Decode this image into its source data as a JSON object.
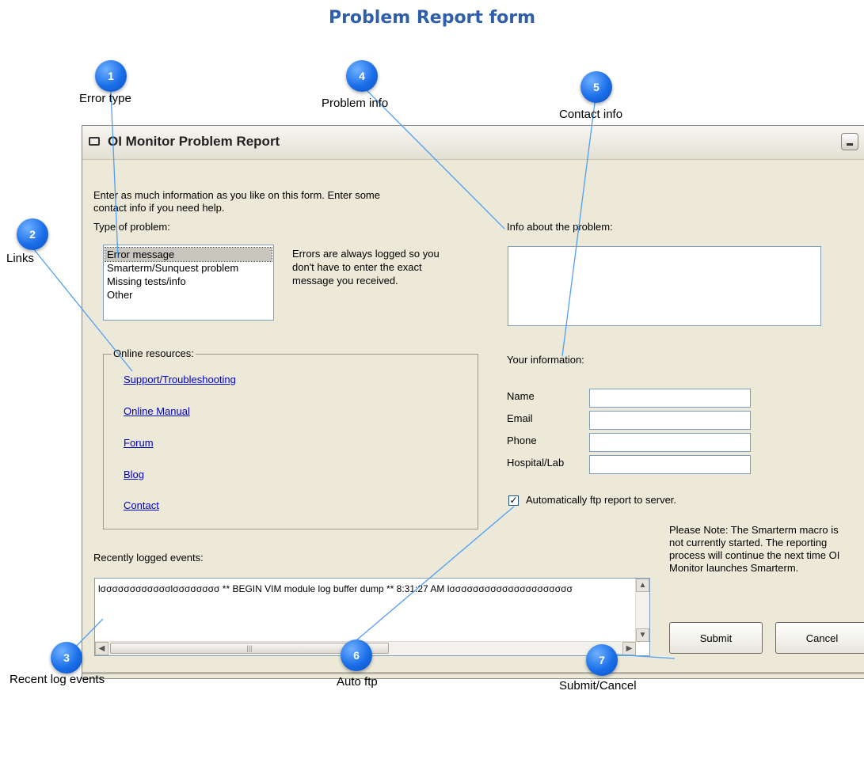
{
  "page_title": "Problem Report form",
  "callouts": [
    {
      "num": "1",
      "label": "Error type"
    },
    {
      "num": "2",
      "label": "Links"
    },
    {
      "num": "3",
      "label": "Recent log events"
    },
    {
      "num": "4",
      "label": "Problem info"
    },
    {
      "num": "5",
      "label": "Contact info"
    },
    {
      "num": "6",
      "label": "Auto ftp"
    },
    {
      "num": "7",
      "label": "Submit/Cancel"
    }
  ],
  "window": {
    "title": "OI Monitor Problem Report",
    "intro_line1": "Enter as much information as you like on this form.  Enter some",
    "intro_line2": "contact info if you need help.",
    "type_label": "Type of problem:",
    "problem_types": [
      "Error message",
      "Smarterm/Sunquest problem",
      "Missing tests/info",
      "Other"
    ],
    "selected_type": "Error message",
    "errors_note_line1": "Errors are always logged so you",
    "errors_note_line2": "don't have to enter the exact",
    "errors_note_line3": "message you received.",
    "online_resources_label": "Online resources:",
    "links": [
      "Support/Troubleshooting",
      "Online Manual",
      "Forum",
      "Blog",
      "Contact"
    ],
    "info_label": "Info about the problem:",
    "info_value": "",
    "your_info_label": "Your information:",
    "fields": {
      "name_label": "Name",
      "email_label": "Email",
      "phone_label": "Phone",
      "hospital_label": "Hospital/Lab"
    },
    "auto_ftp_label": "Automatically ftp report to server.",
    "auto_ftp_checked": true,
    "note_line1": "Please Note: The Smarterm macro is",
    "note_line2": "not currently started.  The reporting",
    "note_line3": "process will continue the next time OI",
    "note_line4": "Monitor launches Smarterm.",
    "recent_label": "Recently logged events:",
    "log_text": "lσσσσσσσσσσσσlσσσσσσσσ ** BEGIN VIM module log buffer dump ** 8:31:27 AM lσσσσσσσσσσσσσσσσσσσσσ",
    "submit_label": "Submit",
    "cancel_label": "Cancel"
  }
}
